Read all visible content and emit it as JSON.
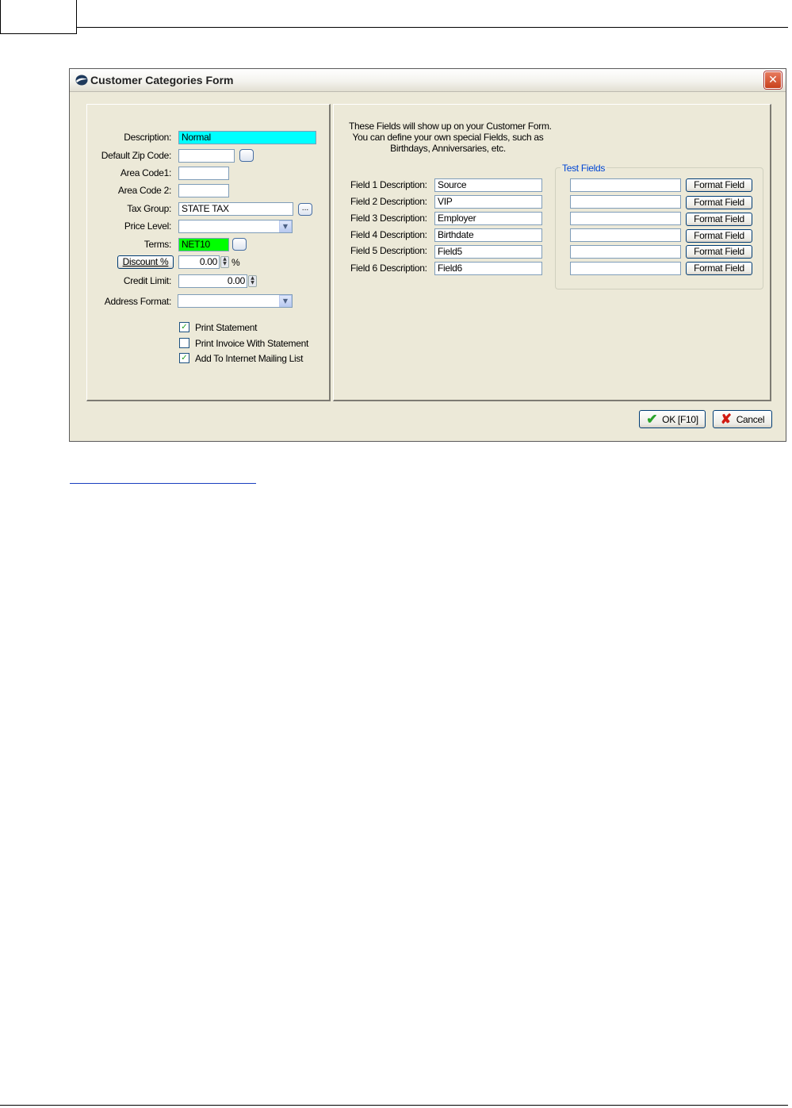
{
  "window": {
    "title": "Customer Categories Form",
    "close_symbol": "✕"
  },
  "left": {
    "description_label": "Description:",
    "description_value": "Normal",
    "zip_label": "Default Zip Code:",
    "zip_value": "",
    "area1_label": "Area Code1:",
    "area1_value": "",
    "area2_label": "Area Code 2:",
    "area2_value": "",
    "taxgroup_label": "Tax Group:",
    "taxgroup_value": "STATE TAX",
    "taxgroup_button": "...",
    "price_label": "Price Level:",
    "price_value": "",
    "terms_label": "Terms:",
    "terms_value": "NET10",
    "discount_button": "Discount %",
    "discount_value": "0.00",
    "discount_unit": "%",
    "credit_label": "Credit Limit:",
    "credit_value": "0.00",
    "address_label": "Address Format:",
    "address_value": "",
    "checkboxes": [
      {
        "label": "Print Statement",
        "checked": true
      },
      {
        "label": "Print Invoice With Statement",
        "checked": false
      },
      {
        "label": "Add To Internet Mailing List",
        "checked": true
      }
    ]
  },
  "right": {
    "info_line1": "These Fields will show up on your Customer Form.",
    "info_line2": "You can define your own special Fields, such as",
    "info_line3": "Birthdays, Anniversaries, etc.",
    "test_fields_title": "Test Fields",
    "format_button": "Format Field",
    "fields": [
      {
        "label": "Field 1 Description:",
        "value": "Source",
        "test": ""
      },
      {
        "label": "Field 2 Description:",
        "value": "VIP",
        "test": ""
      },
      {
        "label": "Field 3 Description:",
        "value": "Employer",
        "test": ""
      },
      {
        "label": "Field 4 Description:",
        "value": "Birthdate",
        "test": ""
      },
      {
        "label": "Field 5 Description:",
        "value": "Field5",
        "test": ""
      },
      {
        "label": "Field 6 Description:",
        "value": "Field6",
        "test": ""
      }
    ]
  },
  "buttons": {
    "ok": "OK [F10]",
    "cancel": "Cancel"
  },
  "icons": {
    "check": "✔",
    "checkbox_mark": "✓",
    "cross": "✘",
    "dropdown": "▼",
    "spin_up": "▲",
    "spin_down": "▼"
  },
  "colors": {
    "description_bg": "#00ffff",
    "terms_bg": "#00ff00",
    "group_title": "#0046d5"
  }
}
